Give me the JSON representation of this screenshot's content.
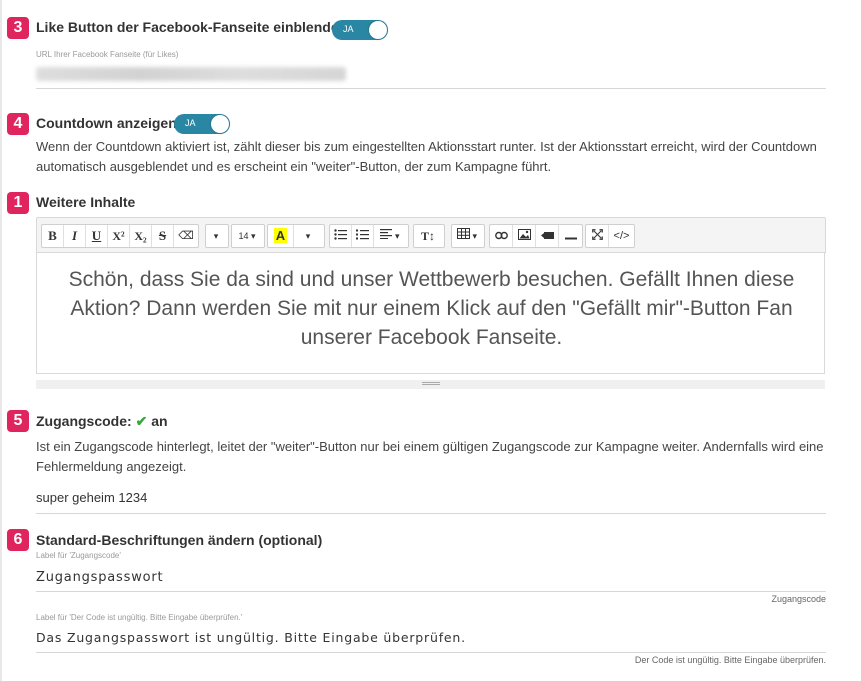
{
  "sections": {
    "like": {
      "number": "3",
      "title": "Like Button der Facebook-Fanseite einblenden",
      "toggle": "JA",
      "url_label": "URL Ihrer Facebook Fanseite (für Likes)"
    },
    "countdown": {
      "number": "4",
      "title": "Countdown anzeigen",
      "toggle": "JA",
      "description": "Wenn der Countdown aktiviert ist, zählt dieser bis zum eingestellten Aktionsstart runter. Ist der Aktionsstart erreicht, wird der Countdown automatisch ausgeblendet und es erscheint ein \"weiter\"-Button, der zum Kampagne führt."
    },
    "content": {
      "number": "1",
      "title": "Weitere Inhalte",
      "editor_text": "Schön, dass Sie da sind und unser Wettbewerb besuchen. Gefällt Ihnen diese Aktion? Dann werden Sie mit nur einem Klick auf den \"Gefällt mir\"-Button Fan unserer Facebook Fanseite."
    },
    "access": {
      "number": "5",
      "title": "Zugangscode:",
      "check": "✔",
      "status": "an",
      "description": "Ist ein Zugangscode hinterlegt, leitet der \"weiter\"-Button nur bei einem gültigen Zugangscode zur Kampagne weiter. Andernfalls wird eine Fehlermeldung angezeigt.",
      "value": "super geheim 1234"
    },
    "labels": {
      "number": "6",
      "title": "Standard-Beschriftungen ändern (optional)",
      "field1_label": "Label für 'Zugangscode'",
      "field1_value": "Zugangspasswort",
      "field1_hint": "Zugangscode",
      "field2_label": "Label für 'Der Code ist ungültig. Bitte Eingabe überprüfen.'",
      "field2_value": "Das Zugangspasswort ist ungültig. Bitte Eingabe überprüfen.",
      "field2_hint": "Der Code ist ungültig. Bitte Eingabe überprüfen."
    }
  },
  "toolbar": {
    "bold": "B",
    "italic": "I",
    "underline": "U",
    "superscript": "X²",
    "subscript": "X₂",
    "strike": "S",
    "eraser": "⌫",
    "dropdown": "▾",
    "font_size": "14",
    "highlight": "A",
    "text_style": "T↕",
    "code": "</>"
  },
  "icons": [
    "bold-icon",
    "italic-icon",
    "underline-icon",
    "superscript-icon",
    "subscript-icon",
    "strikethrough-icon",
    "eraser-icon",
    "font-size-icon",
    "text-color-icon",
    "unordered-list-icon",
    "ordered-list-icon",
    "align-icon",
    "line-height-icon",
    "table-icon",
    "link-icon",
    "image-icon",
    "video-icon",
    "horizontal-rule-icon",
    "fullscreen-icon",
    "code-view-icon"
  ],
  "colors": {
    "badge": "#e0245e",
    "toggle": "#2a87a3",
    "check": "#3aa63a"
  }
}
